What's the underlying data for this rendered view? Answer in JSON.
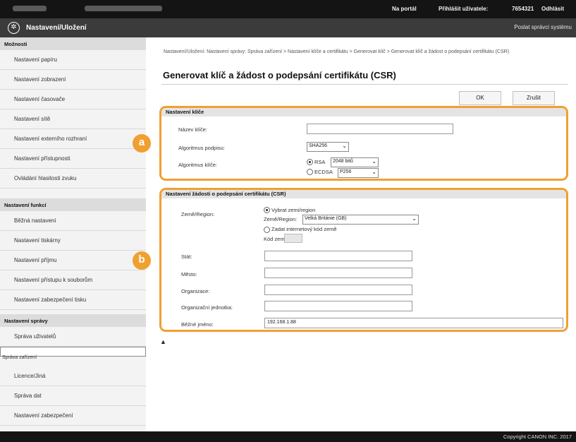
{
  "header": {
    "portal_link": "Na portál",
    "user_label": "Přihlášit uživatele:",
    "user_id": "7654321",
    "logout": "Odhlásit",
    "app_title": "Nastavení/Uložení",
    "mail_admin": "Poslat správci systému"
  },
  "sidebar": {
    "sections": [
      {
        "title": "Možnosti",
        "items": [
          "Nastavení papíru",
          "Nastavení zobrazení",
          "Nastavení časovače",
          "Nastavení sítě",
          "Nastavení externího rozhraní",
          "Nastavení přístupnosti",
          "Ovládání hlasitosti zvuku"
        ]
      },
      {
        "title": "Nastavení funkcí",
        "items": [
          "Běžná nastavení",
          "Nastavení tiskárny",
          "Nastavení příjmu",
          "Nastavení přístupu k souborům",
          "Nastavení zabezpečení tisku"
        ]
      },
      {
        "title": "Nastavení správy",
        "items": [
          "Správa uživatelů",
          "Správa zařízení",
          "Licence/Jiná",
          "Správa dat",
          "Nastavení zabezpečení"
        ]
      }
    ]
  },
  "main": {
    "breadcrumb": "Nastavení/Uložení: Nastavení správy: Správa zařízení > Nastavení klíče a certifikátu > Generovat klíč > Generovat klíč a žádost o podepsání certifikátu (CSR)",
    "title": "Generovat klíč a žádost o podepsání certifikátu (CSR)",
    "ok_label": "OK",
    "cancel_label": "Zrušit",
    "key_section": {
      "title": "Nastavení klíče",
      "key_name_label": "Název klíče:",
      "key_name_value": "",
      "sig_alg_label": "Algoritmus podpisu:",
      "sig_alg_value": "SHA256",
      "key_alg_label": "Algoritmus klíče:",
      "rsa_label": "RSA",
      "rsa_value": "2048 bitů",
      "ecdsa_label": "ECDSA",
      "ecdsa_value": "P256"
    },
    "csr_section": {
      "title": "Nastavení žádosti o podepsání certifikátu (CSR)",
      "country_label": "Země/Region:",
      "select_country_label": "Vybrat zemi/region",
      "country_sub_label": "Země/Region:",
      "country_value": "Velká Británie (GB)",
      "internet_code_label": "Zadat internetový kód země",
      "country_code_label": "Kód země:",
      "country_code_value": "",
      "state_label": "Stát:",
      "state_value": "",
      "city_label": "Město:",
      "city_value": "",
      "org_label": "Organizace:",
      "org_value": "",
      "org_unit_label": "Organizační jednotka:",
      "org_unit_value": "",
      "common_name_label": "Běžné jméno:",
      "common_name_value": "192.168.1.88"
    },
    "callouts": {
      "a": "a",
      "b": "b"
    },
    "top_link": "▲"
  },
  "footer": {
    "copyright": "Copyright CANON INC. 2017"
  },
  "colors": {
    "accent": "#f0a030",
    "topbar": "#141414",
    "titlebar": "#3b3b3b",
    "sidebar": "#f3f3f3"
  }
}
